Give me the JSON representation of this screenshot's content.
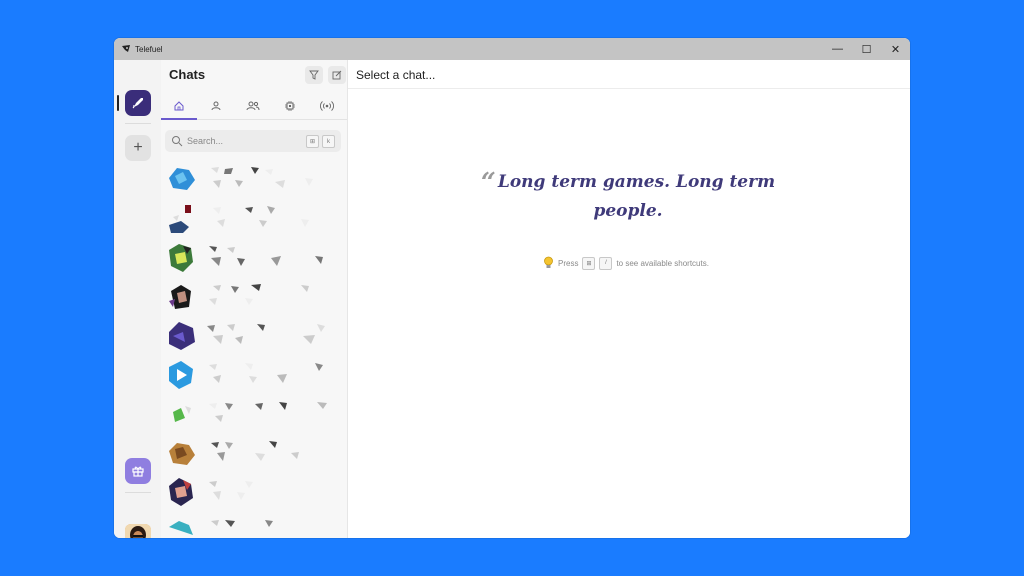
{
  "window": {
    "title": "Telefuel",
    "controls": [
      "—",
      "☐",
      "✕"
    ]
  },
  "rail": {
    "add_label": "+"
  },
  "chatlist": {
    "title": "Chats",
    "search_placeholder": "Search...",
    "search_key": "k",
    "tabs": [
      "home",
      "user",
      "users",
      "chip",
      "radio"
    ]
  },
  "main": {
    "header_title": "Select a chat...",
    "quote_mark": "“",
    "quote_text": "Long term games. Long term people.",
    "tip_prefix": "Press",
    "tip_key": "/",
    "tip_suffix": "to see available shortcuts."
  },
  "colors": {
    "desktop": "#1a7cff",
    "accent": "#6a5acd",
    "rail_active": "#3a2d7a",
    "quote": "#3f3a7a"
  }
}
